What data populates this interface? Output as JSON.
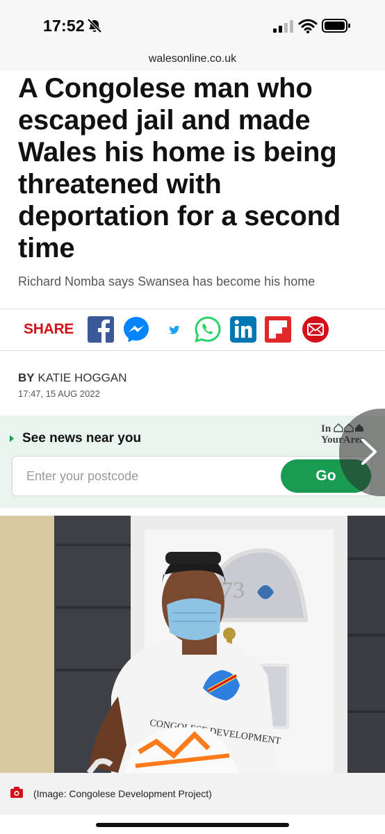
{
  "status_bar": {
    "time": "17:52",
    "icons": [
      "bell-slash-icon",
      "signal-icon",
      "wifi-icon",
      "battery-icon"
    ]
  },
  "browser": {
    "url": "walesonline.co.uk"
  },
  "article": {
    "headline": "A Congolese man who escaped jail and made Wales his home is being threatened with deportation for a second time",
    "subheadline": "Richard Nomba says Swansea has become his home",
    "byline_prefix": "BY",
    "author": "KATIE HOGGAN",
    "timestamp": "17:47, 15 AUG 2022"
  },
  "share": {
    "label": "SHARE",
    "icons": [
      "facebook-icon",
      "messenger-icon",
      "twitter-icon",
      "whatsapp-icon",
      "linkedin-icon",
      "flipboard-icon",
      "email-icon"
    ],
    "colors": {
      "share_label": "#d4111a",
      "facebook": "#3b5998",
      "messenger": "#0084ff",
      "twitter": "#1da1f2",
      "whatsapp": "#25d366",
      "linkedin": "#0077b5",
      "flipboard": "#e12828",
      "email": "#d4111a"
    }
  },
  "news_near_you": {
    "title": "See news near you",
    "logo_line1": "In",
    "logo_line2": "YourArea",
    "placeholder": "Enter your postcode",
    "button": "Go",
    "accent": "#1a9b52"
  },
  "image": {
    "caption": "(Image: Congolese Development Project)",
    "shirt_text": "CONGOLESE DEVELOPMENT",
    "door_number": "73"
  }
}
